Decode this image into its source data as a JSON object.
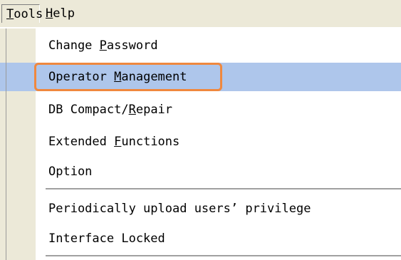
{
  "menubar": {
    "items": [
      {
        "pre": "",
        "mnemonic": "T",
        "post": "ools"
      },
      {
        "pre": "",
        "mnemonic": "H",
        "post": "elp"
      }
    ]
  },
  "menu": {
    "items": [
      {
        "pre": "Change ",
        "mnemonic": "P",
        "post": "assword"
      },
      {
        "pre": "Operator ",
        "mnemonic": "M",
        "post": "anagement"
      },
      {
        "pre": "DB Compact/",
        "mnemonic": "R",
        "post": "epair"
      },
      {
        "pre": "Extended ",
        "mnemonic": "F",
        "post": "unctions"
      },
      {
        "pre": "Option",
        "mnemonic": "",
        "post": ""
      },
      {
        "pre": "Periodically upload users’ privilege",
        "mnemonic": "",
        "post": ""
      },
      {
        "pre": "Interface Locked",
        "mnemonic": "",
        "post": ""
      }
    ],
    "selected_index": 1
  },
  "colors": {
    "menubar_bg": "#ece9d8",
    "selection": "#aec6eb",
    "annotation": "#f0883e"
  }
}
